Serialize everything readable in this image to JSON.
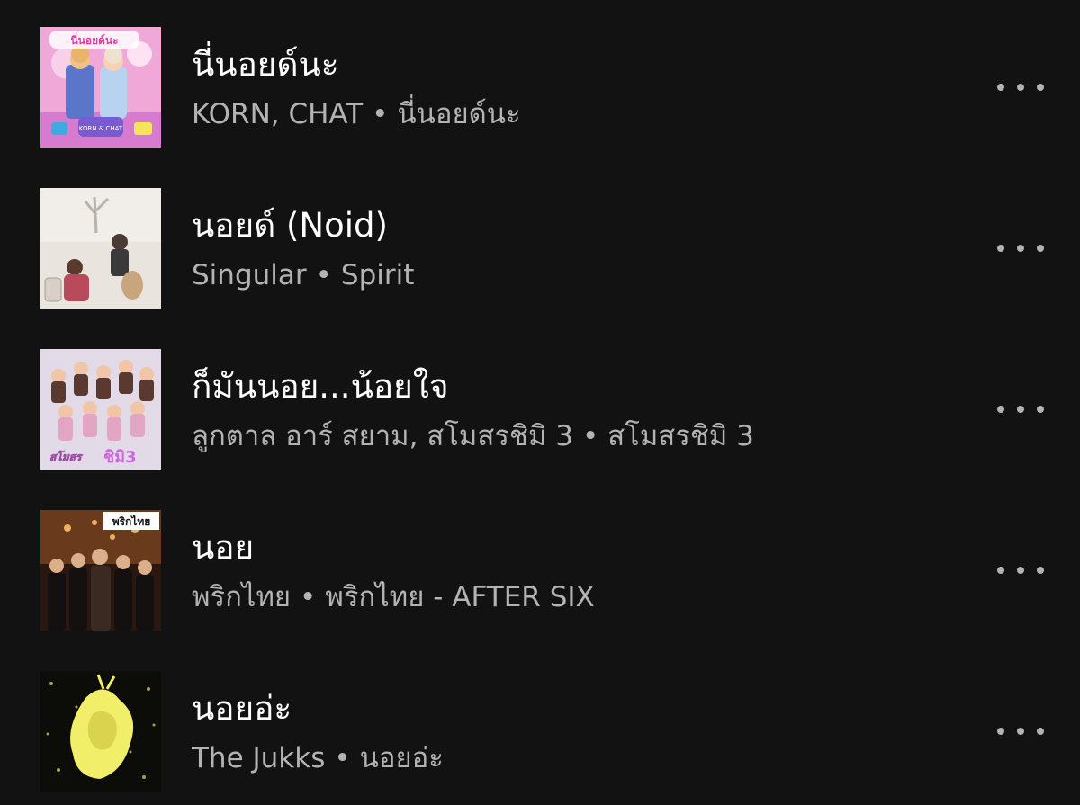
{
  "tracks": [
    {
      "title": "นี่นอยด์นะ",
      "artists": "KORN, CHAT",
      "album": "นี่นอยด์นะ",
      "cover_text": "นี่นอยด์นะ",
      "cover_sub": "KORN & CHAT"
    },
    {
      "title": "นอยด์ (Noid)",
      "artists": "Singular",
      "album": "Spirit"
    },
    {
      "title": "ก็มันนอย...น้อยใจ",
      "artists": "ลูกตาล อาร์ สยาม, สโมสรชิมิ 3",
      "album": "สโมสรชิมิ 3",
      "cover_text": "สโมสร",
      "cover_sub": "ชิมิ3"
    },
    {
      "title": "นอย",
      "artists": "พริกไทย",
      "album": "พริกไทย - AFTER SIX",
      "cover_text": "พริกไทย"
    },
    {
      "title": "นอยอ่ะ",
      "artists": "The Jukks",
      "album": "นอยอ่ะ"
    }
  ],
  "separator": "•",
  "colors": {
    "background": "#121212",
    "title": "#ffffff",
    "subtitle": "#b3b3b3"
  }
}
